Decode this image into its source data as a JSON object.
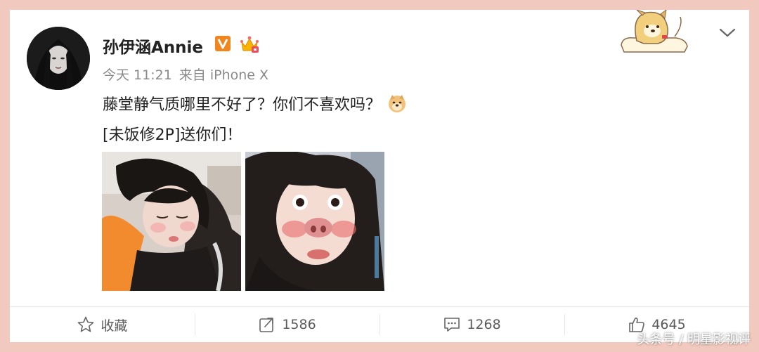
{
  "post": {
    "username": "孙伊涵Annie",
    "time": "今天 11:21",
    "source": "来自 iPhone X",
    "line1": "藤堂静气质哪里不好了？你们不喜欢吗？",
    "line2": "[未饭修2P]送你们！"
  },
  "actions": {
    "favorite_label": "收藏",
    "repost_count": "1586",
    "comment_count": "1268",
    "like_count": "4645"
  },
  "watermark": "头条号 / 明星影视评",
  "colors": {
    "frame": "#f2c9bf",
    "vip_badge": "#f0861d",
    "text_primary": "#222222",
    "text_meta": "#8a8a8a"
  },
  "icons": [
    "verified-v-icon",
    "crown-badge-icon",
    "doge-emoji-icon",
    "dog-sticker",
    "chevron-down-icon",
    "star-icon",
    "repost-icon",
    "comment-icon",
    "thumbs-up-icon"
  ]
}
